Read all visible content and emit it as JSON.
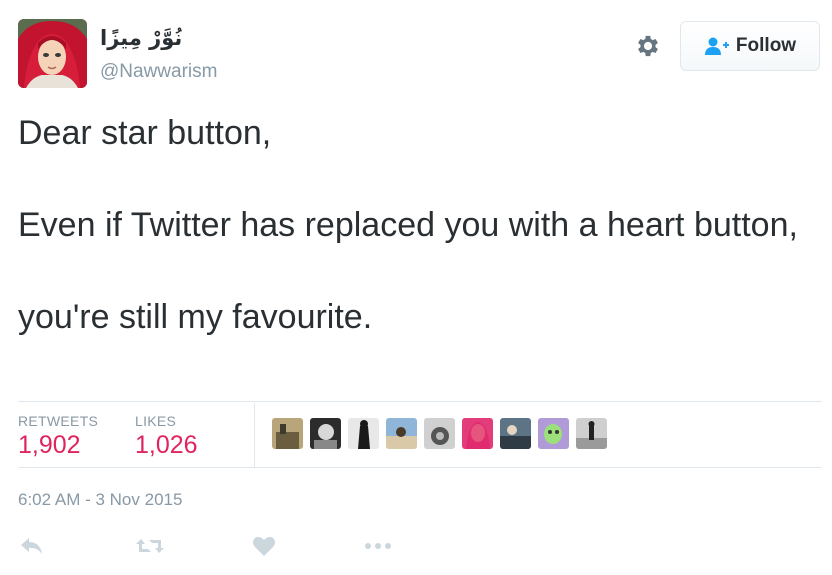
{
  "user": {
    "display_name": "نُوَّرْ مِيزًا",
    "handle": "@Nawwarism",
    "avatar_icon": "avatar-woman-red-hijab",
    "verified": false
  },
  "header": {
    "settings_icon": "gear-icon",
    "follow_label": "Follow",
    "follow_icon": "add-user-icon"
  },
  "tweet": {
    "lines": [
      "Dear star button,",
      "Even if Twitter has replaced you with a heart button,",
      "you're still my favourite."
    ]
  },
  "stats": {
    "retweets_label": "RETWEETS",
    "retweets_value": "1,902",
    "likes_label": "LIKES",
    "likes_value": "1,026"
  },
  "likers": [
    "liker-avatar-1",
    "liker-avatar-2",
    "liker-avatar-3",
    "liker-avatar-4",
    "liker-avatar-5",
    "liker-avatar-6",
    "liker-avatar-7",
    "liker-avatar-8",
    "liker-avatar-9"
  ],
  "timestamp": "6:02 AM - 3 Nov 2015",
  "actions": [
    "reply-icon",
    "retweet-icon",
    "like-icon",
    "more-icon"
  ],
  "colors": {
    "text": "#292f33",
    "muted": "#8899a6",
    "stat_value": "#e0245e",
    "follow_accent": "#1da1f2",
    "divider": "#e1e8ed",
    "action_icon": "#ccd6dd"
  }
}
